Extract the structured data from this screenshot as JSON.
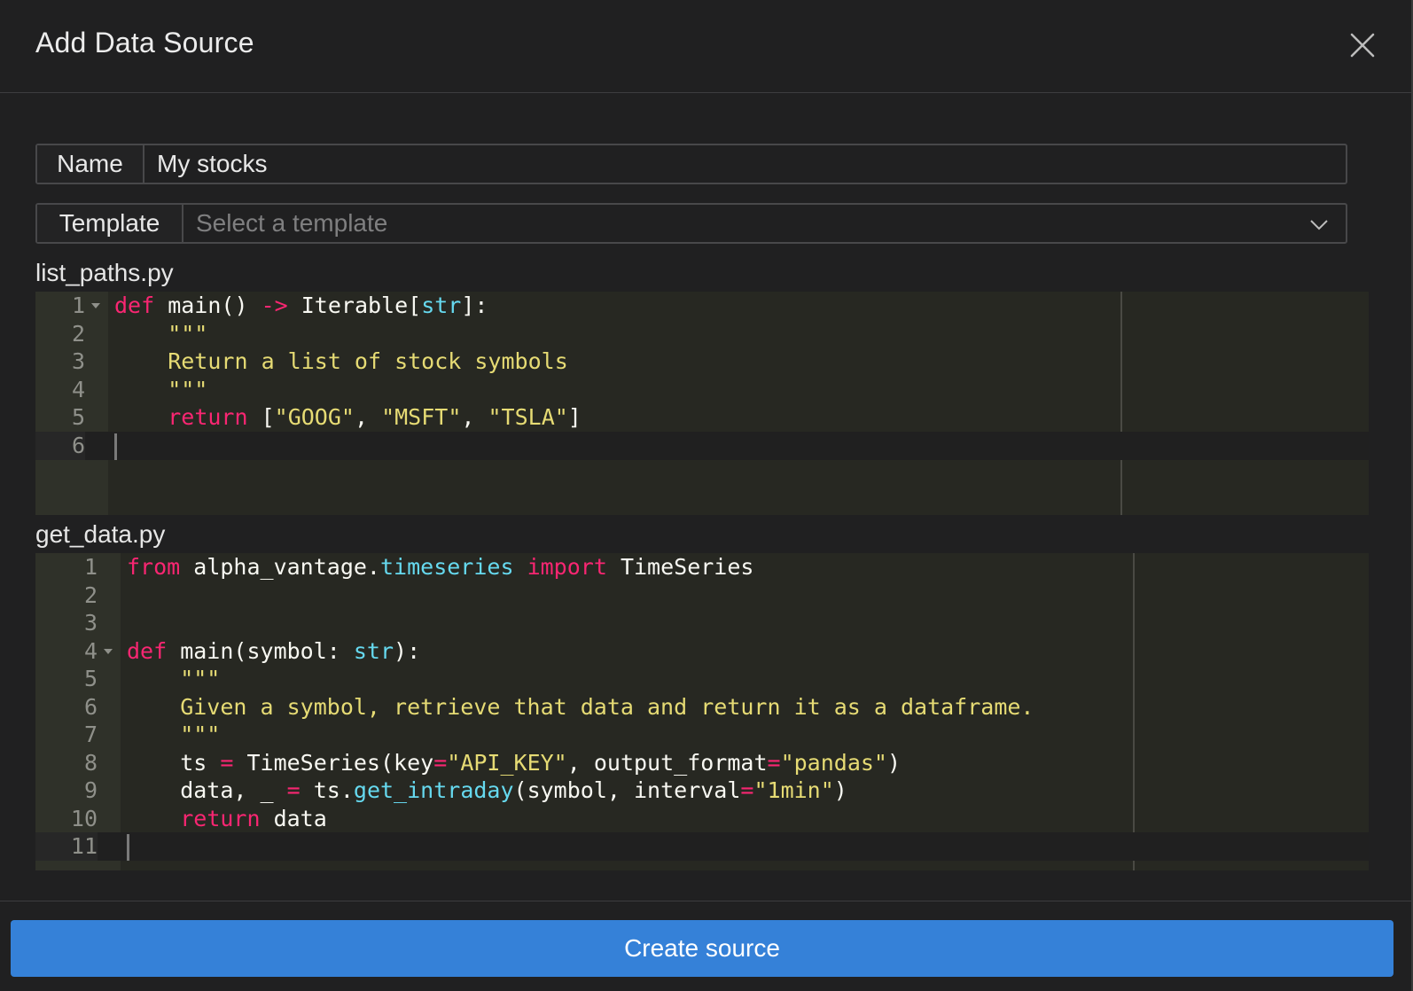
{
  "header": {
    "title": "Add Data Source"
  },
  "form": {
    "name_label": "Name",
    "name_value": "My stocks",
    "template_label": "Template",
    "template_placeholder": "Select a template"
  },
  "editors": {
    "list_paths": {
      "filename": "list_paths.py",
      "line_numbers": [
        "1",
        "2",
        "3",
        "4",
        "5",
        "6"
      ]
    },
    "get_data": {
      "filename": "get_data.py",
      "line_numbers": [
        "1",
        "2",
        "3",
        "4",
        "5",
        "6",
        "7",
        "8",
        "9",
        "10",
        "11"
      ]
    }
  },
  "footer": {
    "create_label": "Create source"
  }
}
